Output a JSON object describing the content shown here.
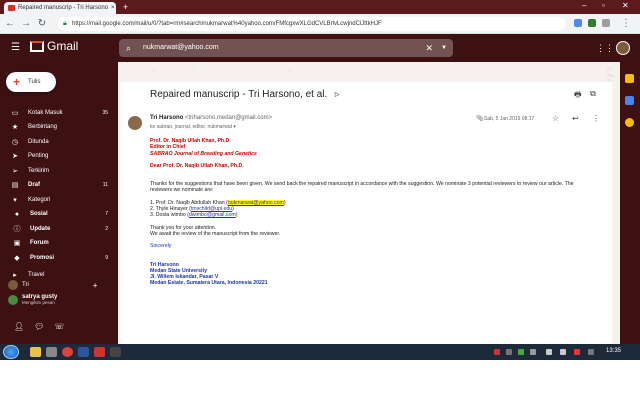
{
  "browser": {
    "tab_title": "Repaired manuscrip - Tri Harsono",
    "tab_close": "×",
    "new_tab": "+",
    "url": "https://mail.google.com/mail/u/0/?tab=rm#search/nukmarwat%40yahoo.com/FMfcgxwXLGdCVLBrlvLcwjndClJttkHJF"
  },
  "gmail": {
    "logo_text": "Gmail",
    "search": {
      "value": "nukmarwat@yahoo.com"
    },
    "compose_label": "Tulis",
    "nav": [
      {
        "label": "Kotak Masuk",
        "count": "35",
        "icon": "inbox-icon",
        "glyph": "▭"
      },
      {
        "label": "Berbintang",
        "count": "",
        "icon": "star-icon",
        "glyph": "★"
      },
      {
        "label": "Ditunda",
        "count": "",
        "icon": "clock-icon",
        "glyph": "◷"
      },
      {
        "label": "Penting",
        "count": "",
        "icon": "important-icon",
        "glyph": "➤"
      },
      {
        "label": "Terkirim",
        "count": "",
        "icon": "send-icon",
        "glyph": "➢"
      },
      {
        "label": "Draf",
        "count": "11",
        "icon": "draft-icon",
        "glyph": "▤",
        "bold": true
      },
      {
        "label": "Kategori",
        "count": "",
        "icon": "category-icon",
        "glyph": "▾"
      }
    ],
    "categories": [
      {
        "label": "Sosial",
        "count": "7",
        "icon": "social-icon",
        "glyph": "●"
      },
      {
        "label": "Update",
        "count": "2",
        "icon": "update-icon",
        "glyph": "ⓘ"
      },
      {
        "label": "Forum",
        "count": "",
        "icon": "forum-icon",
        "glyph": "▣"
      },
      {
        "label": "Promosi",
        "count": "9",
        "icon": "promo-icon",
        "glyph": "◆"
      }
    ],
    "more_label": "Travel",
    "hangouts": {
      "self_name": "Tri",
      "contact_name": "satrya gusty",
      "contact_status": "Mengikim pesan"
    },
    "pager": "25 dari 30",
    "email": {
      "subject": "Repaired manuscrip - Tri Harsono, et al.",
      "sender_name": "Tri Harsono",
      "sender_email": "<triharsono.medan@gmail.com>",
      "to_line": "ke sabrao, journal, editor, nukmarwat",
      "date": "Sab, 5 Jan 2019 08.17",
      "greeting_lines": [
        "Prof. Dr. Naqib Ullah Khan, Ph.D",
        "Editor in Chief"
      ],
      "journal": "SABRAO Journal of Breeding and Genetics",
      "dear": "Dear Prof. Dr.  Naqib Ullah Khan, Ph.D.",
      "para1": "Thanks for the suggestions that have been given. We send back the repaired manuscript in accordance with the suggestion. We nominate 3 potential reviewers to review our article. The reviewers we nominate are:",
      "reviewers": [
        {
          "name": "1. Prof. Dr. Naqib Abdullah Khan (",
          "email": "nukmarwat@yahoo.com",
          "end": ")"
        },
        {
          "name": "2. Thyle Hinayer (",
          "email": "tmschild@upi.edu",
          "end": ")"
        },
        {
          "name": "3. Dosta wimbo (",
          "email": "dwimbo@gmail.com",
          "end": ")"
        }
      ],
      "thanks": "Thank you for your attention.",
      "await": "We await the review of the manuscript from the reviewer.",
      "sincerely": "Sincerely",
      "sig": [
        "Tri Harsono",
        "Medan State University",
        "Jl. Willem Iskandar, Pasar V",
        "Medan Estate, Sumatera Utara, Indonesia 20221"
      ]
    }
  },
  "taskbar": {
    "clock": "13:35"
  },
  "colors": {
    "theme_dark": "#3d1012",
    "accent_red": "#cc0000",
    "link_blue": "#1a36b0",
    "highlight": "#ffff00"
  }
}
